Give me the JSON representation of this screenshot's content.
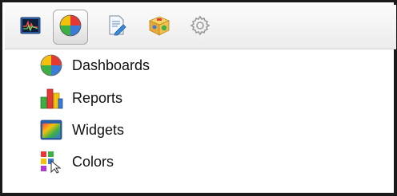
{
  "toolbar": {
    "buttons": [
      {
        "icon": "monitor-chart-icon",
        "active": false
      },
      {
        "icon": "pie-chart-icon",
        "active": true
      },
      {
        "icon": "document-edit-icon",
        "active": false
      },
      {
        "icon": "package-box-icon",
        "active": false
      },
      {
        "icon": "gear-icon",
        "active": false
      }
    ]
  },
  "menu": {
    "items": [
      {
        "label": "Dashboards",
        "icon": "pie-chart-icon"
      },
      {
        "label": "Reports",
        "icon": "bar-chart-icon"
      },
      {
        "label": "Widgets",
        "icon": "widget-window-icon"
      },
      {
        "label": "Colors",
        "icon": "color-palette-icon"
      }
    ]
  },
  "colors": {
    "pie_green": "#3cb043",
    "pie_blue": "#3a7bd5",
    "pie_red": "#e53935",
    "pie_yellow": "#f4c20d"
  }
}
